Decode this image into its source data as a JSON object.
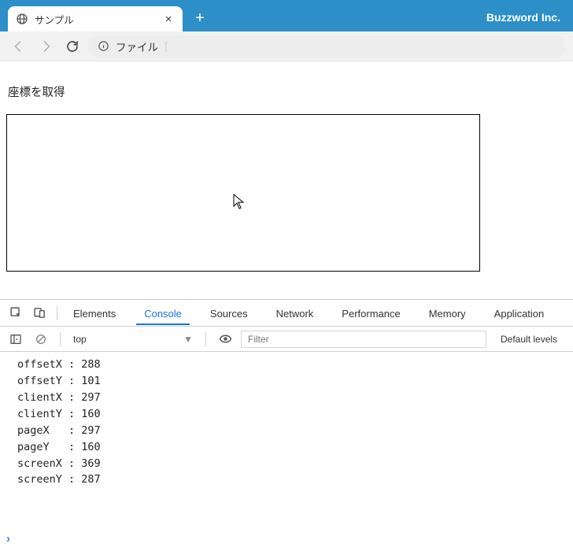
{
  "window": {
    "brand": "Buzzword Inc.",
    "tab": {
      "title": "サンプル"
    },
    "address": {
      "label": "ファイル"
    }
  },
  "page": {
    "heading": "座標を取得"
  },
  "devtools": {
    "tabs": [
      "Elements",
      "Console",
      "Sources",
      "Network",
      "Performance",
      "Memory",
      "Application"
    ],
    "active_tab": "Console",
    "toolbar": {
      "context": "top",
      "filter_placeholder": "Filter",
      "levels": "Default levels"
    },
    "console_lines": [
      "offsetX : 288",
      "offsetY : 101",
      "clientX : 297",
      "clientY : 160",
      "pageX   : 297",
      "pageY   : 160",
      "screenX : 369",
      "screenY : 287"
    ]
  }
}
